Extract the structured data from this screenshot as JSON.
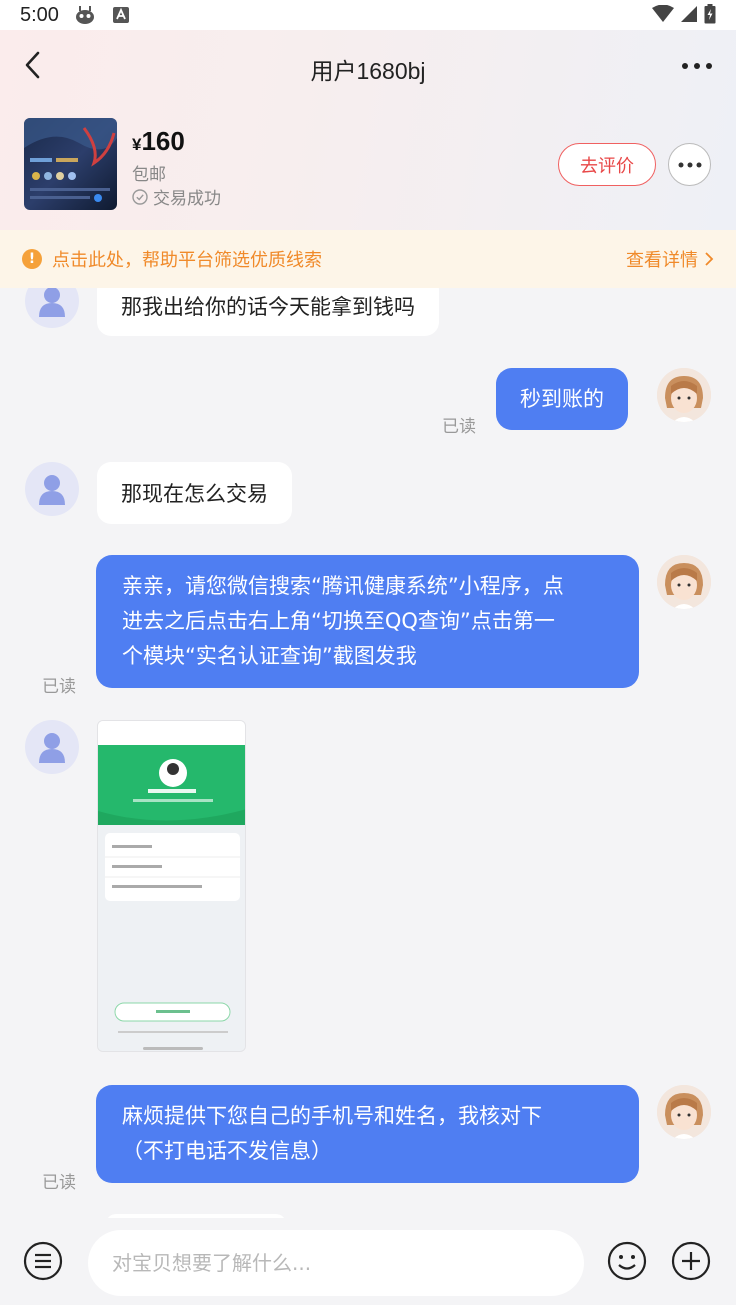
{
  "status_bar": {
    "time": "5:00"
  },
  "header": {
    "title": "用户1680bj"
  },
  "product": {
    "currency": "¥",
    "price": "160",
    "shipping": "包邮",
    "status": "交易成功",
    "review_label": "去评价"
  },
  "notice": {
    "text": "点击此处，帮助平台筛选优质线索",
    "link_label": "查看详情"
  },
  "messages": [
    {
      "side": "in",
      "text": "那我出给你的话今天能拿到钱吗"
    },
    {
      "side": "out",
      "text": "秒到账的",
      "read": "已读"
    },
    {
      "side": "in",
      "text": "那现在怎么交易"
    },
    {
      "side": "out",
      "lines": [
        "亲亲，请您微信搜索“腾讯健康系统”小程序，点",
        "进去之后点击右上角“切换至QQ查询”点击第一",
        "个模块“实名认证查询”截图发我"
      ],
      "read": "已读"
    },
    {
      "side": "in",
      "type": "image"
    },
    {
      "side": "out",
      "lines": [
        "麻烦提供下您自己的手机号和姓名，我核对下",
        "（不打电话不发信息）"
      ],
      "read": "已读"
    }
  ],
  "input": {
    "placeholder": "对宝贝想要了解什么..."
  },
  "colors": {
    "accent_blue": "#4f7ef2",
    "review_red": "#e84848",
    "notice_orange": "#f08a2a"
  },
  "icons": [
    "back-icon",
    "more-icon",
    "check-circle-icon",
    "info-icon",
    "chevron-right-icon",
    "menu-icon",
    "emoji-icon",
    "plus-icon"
  ]
}
